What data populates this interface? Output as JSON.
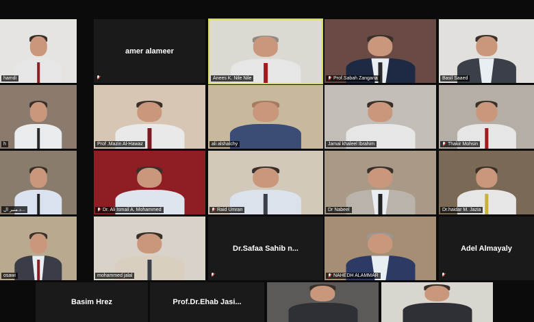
{
  "meeting": {
    "grid_rows": [
      [
        {
          "id": "p1",
          "name": "hamdi",
          "type": "video",
          "muted": false,
          "bg": "#e6e4e0",
          "suit": "#e6e6e6",
          "tie": "#8a1f24"
        },
        {
          "id": "p2",
          "name": "amer alameer",
          "type": "name-only",
          "muted": true
        },
        {
          "id": "p3",
          "name": "Anees K. Nile Nile",
          "type": "video",
          "muted": false,
          "active": true,
          "bg": "#dcd8d2",
          "suit": "#e6e6e6",
          "tie": "#a01a1e"
        },
        {
          "id": "p4",
          "name": "Prof.Sabah Zangana",
          "type": "video",
          "muted": true,
          "bg": "#6a4a44",
          "suit": "#1e2a44",
          "tie": "#2a2a2a"
        },
        {
          "id": "p5",
          "name": "Basil Saaed",
          "type": "video",
          "muted": false,
          "bg": "#e2e0dc",
          "suit": "#3b3f48",
          "tie": "#3b3f48"
        }
      ],
      [
        {
          "id": "p6",
          "name": "h",
          "type": "video",
          "muted": false,
          "bg": "#8b7b6e",
          "suit": "#e9ecef",
          "tie": "#2a2a2a"
        },
        {
          "id": "p7",
          "name": "Prof .Mazin Al-Hawaz",
          "type": "video",
          "muted": false,
          "bg": "#d7c6b4",
          "suit": "#e9e9e9",
          "tie": "#7a1b21"
        },
        {
          "id": "p8",
          "name": "ali alshalchy",
          "type": "video",
          "muted": false,
          "bg": "#c8b89c",
          "suit": "#3b4d77",
          "tie": "#3b4d77"
        },
        {
          "id": "p9",
          "name": "Jamal khaleel Ibrahim",
          "type": "video",
          "muted": false,
          "bg": "#c2bdb7",
          "suit": "#e6e6e6",
          "tie": "#e6e6e6"
        },
        {
          "id": "p10",
          "name": "Thakir Mohsin",
          "type": "video",
          "muted": true,
          "bg": "#b5aea5",
          "suit": "#e6e6e6",
          "tie": "#a01a1e"
        }
      ],
      [
        {
          "id": "p11",
          "name": "د.منير ال...",
          "type": "video",
          "muted": false,
          "bg": "#8a7c6c",
          "suit": "#d9e2ee",
          "tie": "#222"
        },
        {
          "id": "p12",
          "name": "Dr. Ali Ismail A. Mohammed",
          "type": "video",
          "muted": true,
          "bg": "#8e1d24",
          "suit": "#dfe5ee",
          "tie": "#dfe5ee"
        },
        {
          "id": "p13",
          "name": "Raid Umran",
          "type": "video",
          "muted": true,
          "bg": "#d2c9ba",
          "suit": "#dbe2ec",
          "tie": "#3b3f48"
        },
        {
          "id": "p14",
          "name": "Dr Nabeel",
          "type": "video",
          "muted": false,
          "bg": "#a89a86",
          "suit": "#b9b3aa",
          "tie": "#222"
        },
        {
          "id": "p15",
          "name": "Dr.haidar M. Jazia",
          "type": "video",
          "muted": false,
          "bg": "#7a6a55",
          "suit": "#e6e6e6",
          "tie": "#c9b23a"
        }
      ],
      [
        {
          "id": "p16",
          "name": "osawi",
          "type": "video",
          "muted": false,
          "bg": "#b9a98f",
          "suit": "#3a3d46",
          "tie": "#8a1f24"
        },
        {
          "id": "p17",
          "name": "mohammed jalal",
          "type": "video",
          "muted": false,
          "bg": "#d8d2c8",
          "suit": "#d9cfc1",
          "tie": "#3b3f48"
        },
        {
          "id": "p18",
          "name": "Dr.Safaa  Sahib  n...",
          "type": "name-only",
          "muted": true
        },
        {
          "id": "p19",
          "name": "NAHEDH ALAMMAR",
          "type": "video",
          "muted": true,
          "bg": "#a58e74",
          "suit": "#2e3a66",
          "tie": "#2e3a66"
        },
        {
          "id": "p20",
          "name": "Adel Almayaly",
          "type": "name-only",
          "muted": true
        }
      ],
      [
        {
          "id": "p21",
          "name": "Basim Hrez",
          "type": "name-only",
          "muted": false
        },
        {
          "id": "p22",
          "name": "Prof.Dr.Ehab  Jasi...",
          "type": "name-only",
          "muted": false
        },
        {
          "id": "p23",
          "name": "",
          "type": "video",
          "muted": false,
          "bg": "#5c5a58",
          "suit": "#2e3035",
          "tie": "#2e3035"
        },
        {
          "id": "p24",
          "name": "",
          "type": "video",
          "muted": false,
          "bg": "#d9d6d0",
          "suit": "#2e3035",
          "tie": "#2e3035"
        }
      ]
    ]
  }
}
